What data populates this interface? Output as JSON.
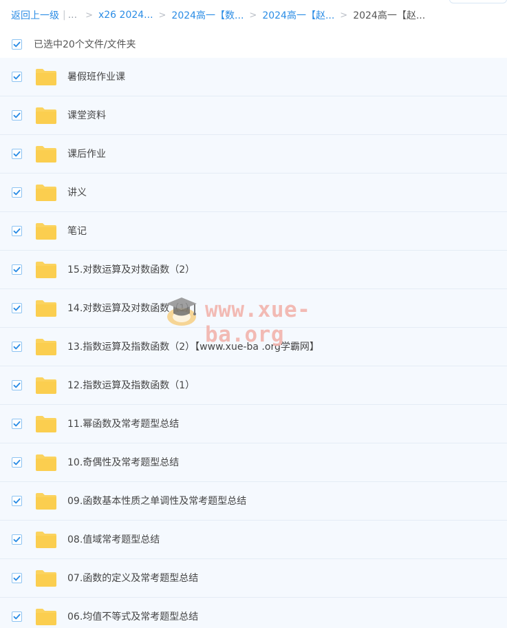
{
  "breadcrumb": {
    "back": "返回上一级",
    "ellipsis": "...",
    "items": [
      "x26 2024...",
      "2024高一【数...",
      "2024高一【赵..."
    ],
    "current": "2024高一【赵..."
  },
  "selection": {
    "label": "已选中20个文件/文件夹",
    "checked": true
  },
  "files": [
    {
      "name": "暑假班作业课",
      "checked": true
    },
    {
      "name": "课堂资料",
      "checked": true
    },
    {
      "name": "课后作业",
      "checked": true
    },
    {
      "name": "讲义",
      "checked": true
    },
    {
      "name": "笔记",
      "checked": true
    },
    {
      "name": "15.对数运算及对数函数（2）",
      "checked": true
    },
    {
      "name": "14.对数运算及对数函数（1）",
      "checked": true
    },
    {
      "name": "13.指数运算及指数函数（2）【www.xue-ba .org学霸网】",
      "checked": true
    },
    {
      "name": "12.指数运算及指数函数（1）",
      "checked": true
    },
    {
      "name": "11.幂函数及常考题型总结",
      "checked": true
    },
    {
      "name": "10.奇偶性及常考题型总结",
      "checked": true
    },
    {
      "name": "09.函数基本性质之单调性及常考题型总结",
      "checked": true
    },
    {
      "name": "08.值域常考题型总结",
      "checked": true
    },
    {
      "name": "07.函数的定义及常考题型总结",
      "checked": true
    },
    {
      "name": "06.均值不等式及常考题型总结",
      "checked": true
    }
  ],
  "watermark": {
    "text": "www.xue-ba.org"
  },
  "colors": {
    "link": "#2a8ce5",
    "check": "#2a8ce5",
    "folder": "#fbd35e",
    "row_bg": "#f5f9fe"
  },
  "icons": {
    "checkbox": "check-icon",
    "folder": "folder-icon",
    "watermark_logo": "graduation-cap-icon"
  }
}
